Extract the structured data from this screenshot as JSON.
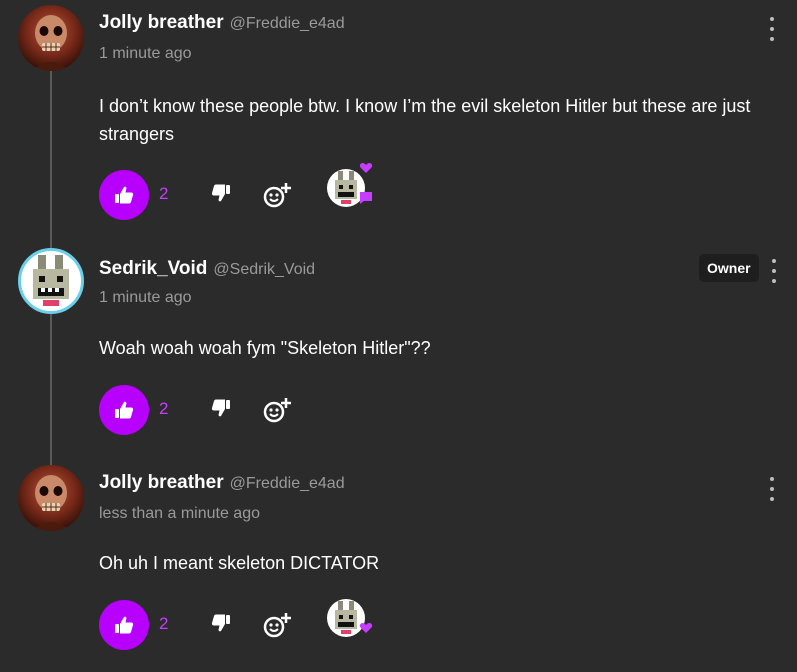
{
  "comments": [
    {
      "author": "Jolly breather",
      "handle": "@Freddie_e4ad",
      "time": "1 minute ago",
      "text": "I don’t know these people btw. I know I’m the evil skeleton Hitler but these are just strangers",
      "likes": "2",
      "avatar": "skull-avatar"
    },
    {
      "author": "Sedrik_Void",
      "handle": "@Sedrik_Void",
      "badge": "Owner",
      "time": "1 minute ago",
      "text": "Woah woah woah fym \"Skeleton Hitler\"??",
      "likes": "2",
      "avatar": "rabbit-avatar"
    },
    {
      "author": "Jolly breather",
      "handle": "@Freddie_e4ad",
      "time": "less than a minute ago",
      "text": "Oh uh I meant skeleton DICTATOR",
      "likes": "2",
      "avatar": "skull-avatar"
    }
  ],
  "colors": {
    "background": "#2b2b2b",
    "accent": "#b800ff",
    "muted": "#9a9a9a",
    "owner_ring": "#6ad0ea"
  },
  "icons": [
    "thumbs-up-icon",
    "thumbs-down-icon",
    "add-reaction-icon",
    "kebab-menu-icon",
    "heart-icon",
    "chat-bubble-icon"
  ]
}
